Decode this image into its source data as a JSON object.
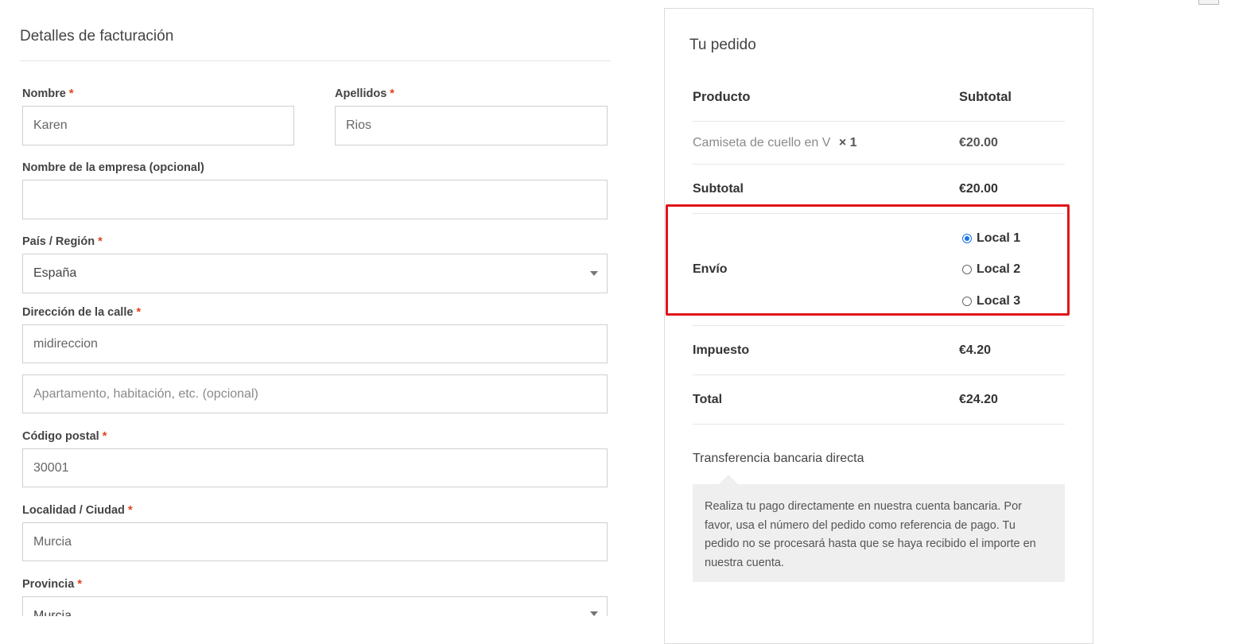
{
  "billing": {
    "title": "Detalles de facturación",
    "required_mark": "*",
    "first_name": {
      "label": "Nombre",
      "value": "Karen"
    },
    "last_name": {
      "label": "Apellidos",
      "value": "Rios"
    },
    "company": {
      "label": "Nombre de la empresa (opcional)",
      "value": ""
    },
    "country": {
      "label": "País / Región",
      "value": "España"
    },
    "street": {
      "label": "Dirección de la calle",
      "value": "midireccion",
      "line2_placeholder": "Apartamento, habitación, etc. (opcional)"
    },
    "postcode": {
      "label": "Código postal",
      "value": "30001"
    },
    "city": {
      "label": "Localidad / Ciudad",
      "value": "Murcia"
    },
    "province": {
      "label": "Provincia",
      "value": "Murcia"
    }
  },
  "order": {
    "title": "Tu pedido",
    "header_product": "Producto",
    "header_subtotal": "Subtotal",
    "item": {
      "name": "Camiseta de cuello en V",
      "qty": "× 1",
      "price": "€20.00"
    },
    "subtotal": {
      "label": "Subtotal",
      "value": "€20.00"
    },
    "shipping": {
      "label": "Envío",
      "options": [
        {
          "label": "Local 1",
          "selected": true
        },
        {
          "label": "Local 2",
          "selected": false
        },
        {
          "label": "Local 3",
          "selected": false
        }
      ]
    },
    "tax": {
      "label": "Impuesto",
      "value": "€4.20"
    },
    "total": {
      "label": "Total",
      "value": "€24.20"
    },
    "payment": {
      "method": "Transferencia bancaria directa",
      "description": "Realiza tu pago directamente en nuestra cuenta bancaria. Por favor, usa el número del pedido como referencia de pago. Tu pedido no se procesará hasta que se haya recibido el importe en nuestra cuenta."
    }
  },
  "colors": {
    "required": "#e2401c",
    "highlight": "#e0151b",
    "radio_selected": "#1a73e8"
  }
}
